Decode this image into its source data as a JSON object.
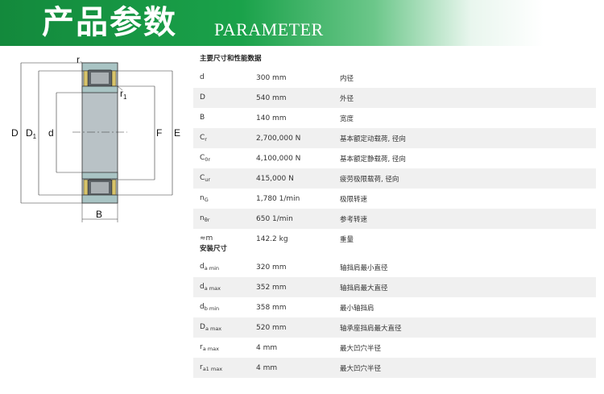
{
  "banner": {
    "title": "产品参数",
    "subtitle": "PARAMETER",
    "color": "#1aa24a"
  },
  "diagram": {
    "labels": {
      "r": "r",
      "r1": "r",
      "r1_sub": "1",
      "D": "D",
      "D1": "D",
      "D1_sub": "1",
      "d": "d",
      "F": "F",
      "E": "E",
      "B": "B"
    }
  },
  "sections": [
    {
      "title": "主要尺寸和性能数据",
      "rows": [
        {
          "sym": "d",
          "sub": "",
          "value": "300 mm",
          "desc": "内径"
        },
        {
          "sym": "D",
          "sub": "",
          "value": "540 mm",
          "desc": "外径"
        },
        {
          "sym": "B",
          "sub": "",
          "value": "140 mm",
          "desc": "宽度"
        },
        {
          "sym": "C",
          "sub": "r",
          "value": "2,700,000 N",
          "desc": "基本额定动载荷, 径向"
        },
        {
          "sym": "C",
          "sub": "0r",
          "value": "4,100,000 N",
          "desc": "基本额定静载荷, 径向"
        },
        {
          "sym": "C",
          "sub": "ur",
          "value": "415,000 N",
          "desc": "疲劳极限载荷, 径向"
        },
        {
          "sym": "n",
          "sub": "G",
          "value": "1,780 1/min",
          "desc": "极限转速"
        },
        {
          "sym": "n",
          "sub": "θr",
          "value": "650 1/min",
          "desc": "参考转速"
        },
        {
          "sym": "≈m",
          "sub": "",
          "value": "142.2 kg",
          "desc": "重量"
        }
      ]
    },
    {
      "title": "安装尺寸",
      "rows": [
        {
          "sym": "d",
          "sub": "a min",
          "value": "320 mm",
          "desc": "轴挡肩最小直径"
        },
        {
          "sym": "d",
          "sub": "a max",
          "value": "352 mm",
          "desc": "轴挡肩最大直径"
        },
        {
          "sym": "d",
          "sub": "b min",
          "value": "358 mm",
          "desc": "最小轴挡肩"
        },
        {
          "sym": "D",
          "sub": "a max",
          "value": "520 mm",
          "desc": "轴承座挡肩最大直径"
        },
        {
          "sym": "r",
          "sub": "a max",
          "value": "4 mm",
          "desc": "最大凹穴半径"
        },
        {
          "sym": "r",
          "sub": "a1 max",
          "value": "4 mm",
          "desc": "最大凹穴半径"
        }
      ]
    }
  ]
}
